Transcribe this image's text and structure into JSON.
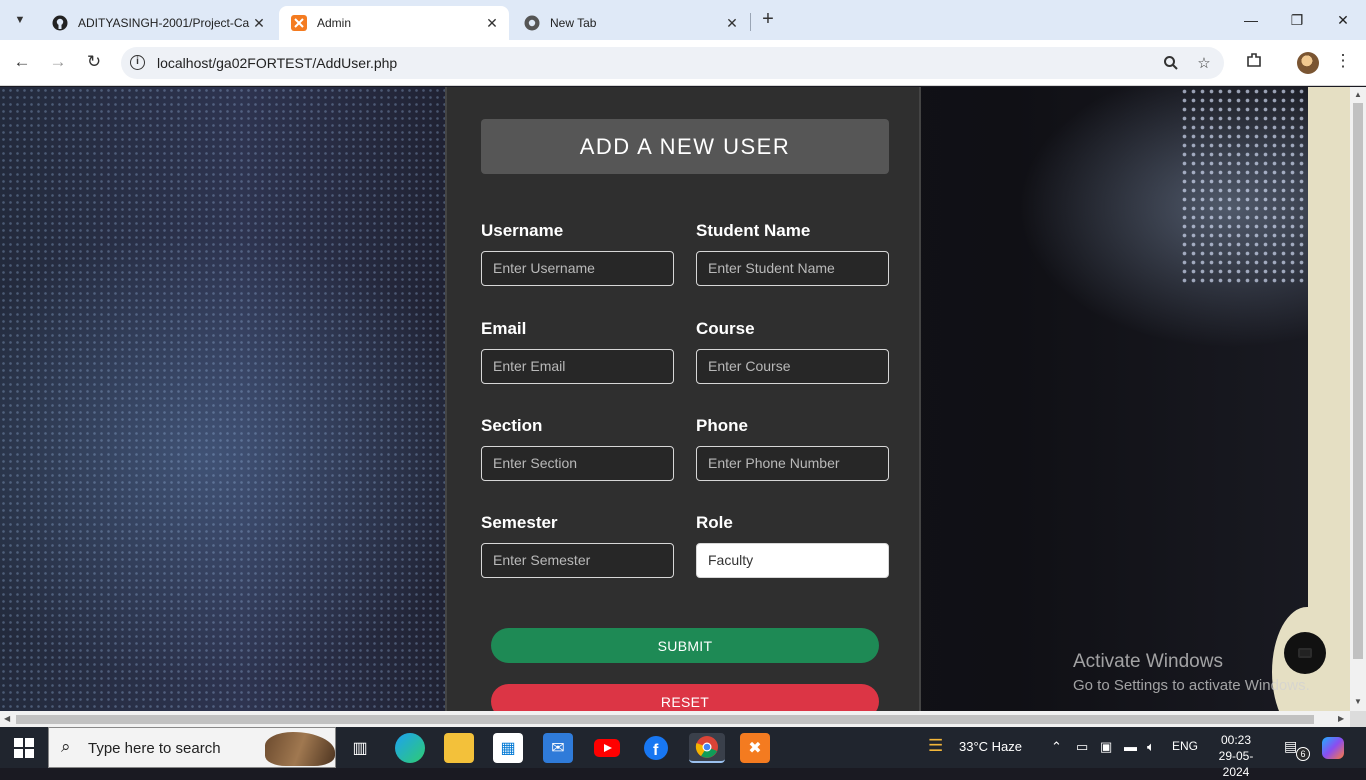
{
  "browser": {
    "tabs": [
      {
        "title": "ADITYASINGH-2001/Project-Ca",
        "icon": "github-icon",
        "active": false
      },
      {
        "title": "Admin",
        "icon": "xampp-icon",
        "active": true
      },
      {
        "title": "New Tab",
        "icon": "chrome-icon",
        "active": false
      }
    ],
    "url": "localhost/ga02FORTEST/AddUser.php"
  },
  "form": {
    "title": "ADD A NEW USER",
    "fields": [
      {
        "label": "Username",
        "placeholder": "Enter Username"
      },
      {
        "label": "Student Name",
        "placeholder": "Enter Student Name"
      },
      {
        "label": "Email",
        "placeholder": "Enter Email"
      },
      {
        "label": "Course",
        "placeholder": "Enter Course"
      },
      {
        "label": "Section",
        "placeholder": "Enter Section"
      },
      {
        "label": "Phone",
        "placeholder": "Enter Phone Number"
      },
      {
        "label": "Semester",
        "placeholder": "Enter Semester"
      },
      {
        "label": "Role",
        "value": "Faculty"
      }
    ],
    "submit_label": "SUBMIT",
    "reset_label": "RESET"
  },
  "watermark": {
    "line1": "Activate Windows",
    "line2": "Go to Settings to activate Windows."
  },
  "taskbar": {
    "search_placeholder": "Type here to search",
    "weather": "33°C  Haze",
    "language": "ENG",
    "time": "00:23",
    "date": "29-05-2024",
    "notification_count": "6"
  },
  "colors": {
    "submit": "#1e8a55",
    "reset": "#dc3545",
    "card": "#2f2f2f"
  }
}
